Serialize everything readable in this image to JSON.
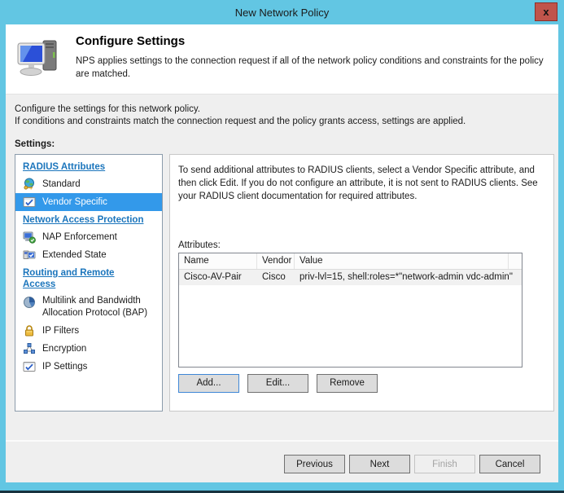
{
  "window": {
    "title": "New Network Policy",
    "close": "x"
  },
  "colors": {
    "titlebar_blue": "#62c6e3",
    "close_button_red": "#c0544b",
    "selected_item_blue": "#3399ea",
    "section_heading_blue": "#1b75bc"
  },
  "header": {
    "title": "Configure Settings",
    "description": "NPS applies settings to the connection request if all of the network policy conditions and constraints for the policy are matched."
  },
  "intro": {
    "line1": "Configure the settings for this network policy.",
    "line2": "If conditions and constraints match the connection request and the policy grants access, settings are applied.",
    "settings_label": "Settings:"
  },
  "nav": {
    "sections": [
      {
        "label": "RADIUS Attributes"
      },
      {
        "label": "Network Access Protection"
      },
      {
        "label": "Routing and Remote Access"
      }
    ],
    "items": [
      {
        "label": "Standard",
        "icon": "globe-key-icon"
      },
      {
        "label": "Vendor Specific",
        "icon": "checklist-icon",
        "selected": true
      },
      {
        "label": "NAP Enforcement",
        "icon": "computer-shield-icon"
      },
      {
        "label": "Extended State",
        "icon": "computer-check-icon"
      },
      {
        "label": "Multilink and Bandwidth Allocation Protocol (BAP)",
        "icon": "pie-chart-icon"
      },
      {
        "label": "IP Filters",
        "icon": "padlock-icon"
      },
      {
        "label": "Encryption",
        "icon": "network-nodes-icon"
      },
      {
        "label": "IP Settings",
        "icon": "checkbox-icon"
      }
    ]
  },
  "vendor_panel": {
    "description": "To send additional attributes to RADIUS clients, select a Vendor Specific attribute, and then click Edit. If you do not configure an attribute, it is not sent to RADIUS clients. See your RADIUS client documentation for required attributes.",
    "attributes_label": "Attributes:",
    "columns": [
      "Name",
      "Vendor",
      "Value"
    ],
    "rows": [
      {
        "name": "Cisco-AV-Pair",
        "vendor": "Cisco",
        "value": "priv-lvl=15, shell:roles=*\"network-admin vdc-admin\""
      }
    ],
    "buttons": {
      "add": "Add...",
      "edit": "Edit...",
      "remove": "Remove"
    }
  },
  "footer": {
    "previous": "Previous",
    "next": "Next",
    "finish": "Finish",
    "cancel": "Cancel"
  }
}
